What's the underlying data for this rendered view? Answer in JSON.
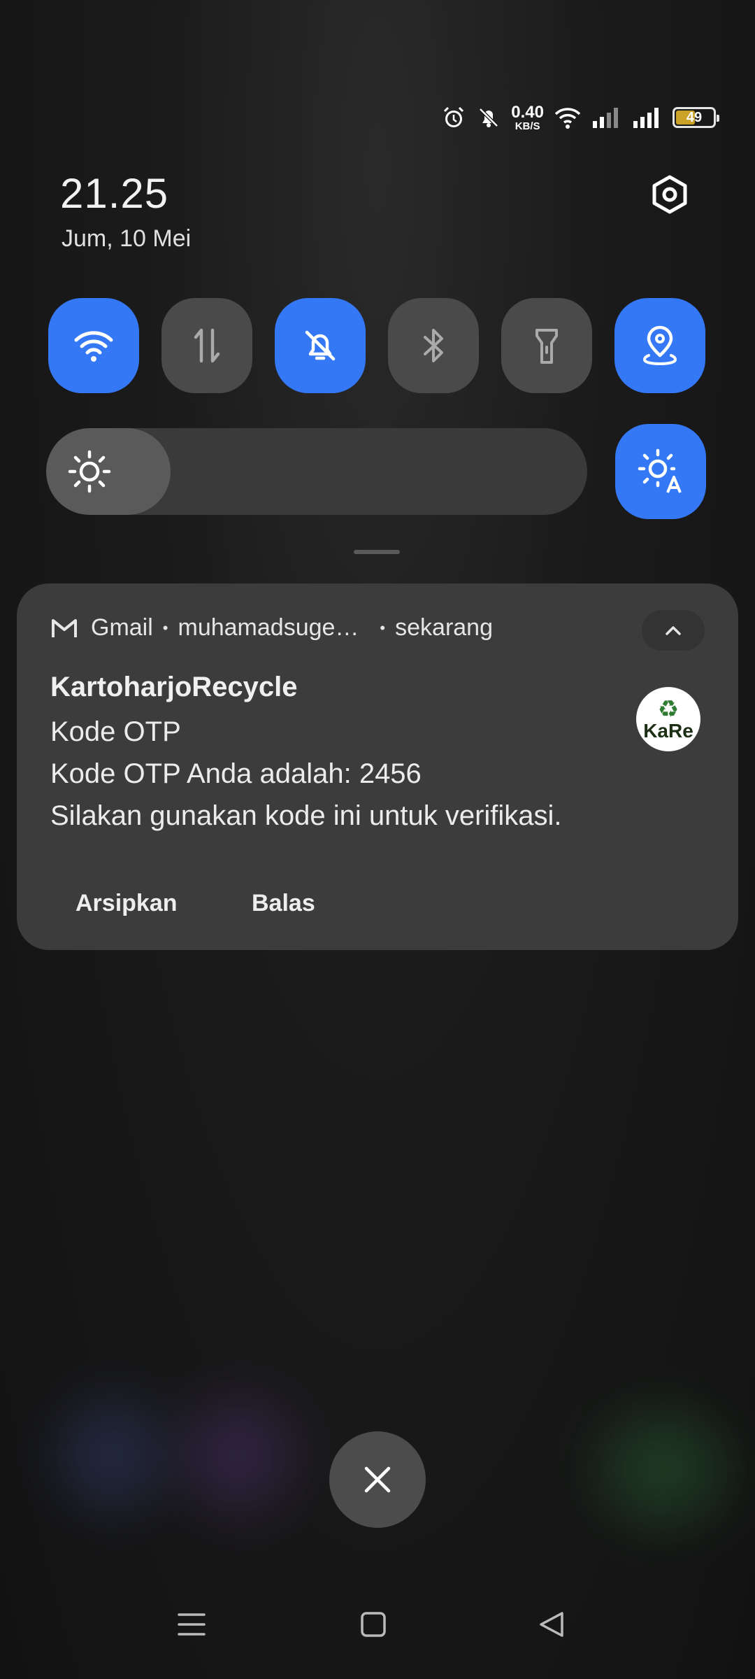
{
  "status_bar": {
    "net_speed_value": "0.40",
    "net_speed_unit": "KB/S",
    "battery_level": "49",
    "icons": [
      "alarm-icon",
      "mute-icon",
      "wifi-icon",
      "signal-icon",
      "signal-icon",
      "battery-icon"
    ]
  },
  "clock": {
    "time": "21.25",
    "date": "Jum, 10 Mei"
  },
  "quick_settings": {
    "tiles": [
      {
        "icon": "wifi-icon",
        "on": true
      },
      {
        "icon": "mobile-data-icon",
        "on": false
      },
      {
        "icon": "silent-mode-icon",
        "on": true
      },
      {
        "icon": "bluetooth-icon",
        "on": false
      },
      {
        "icon": "flashlight-icon",
        "on": false
      },
      {
        "icon": "location-icon",
        "on": true
      }
    ],
    "brightness_level": 0.23,
    "auto_brightness_on": true
  },
  "notification": {
    "app": "Gmail",
    "account": "muhamadsuge…",
    "time": "sekarang",
    "title": "KartoharjoRecycle",
    "subject": "Kode OTP",
    "body_line1": "Kode OTP Anda adalah: 2456",
    "body_line2": "Silakan gunakan kode ini untuk verifikasi.",
    "avatar_text": "KaRe",
    "actions": [
      "Arsipkan",
      "Balas"
    ]
  },
  "colors": {
    "accent": "#3478f6",
    "tile_off": "#4a4a4a",
    "card": "#3c3c3c"
  }
}
